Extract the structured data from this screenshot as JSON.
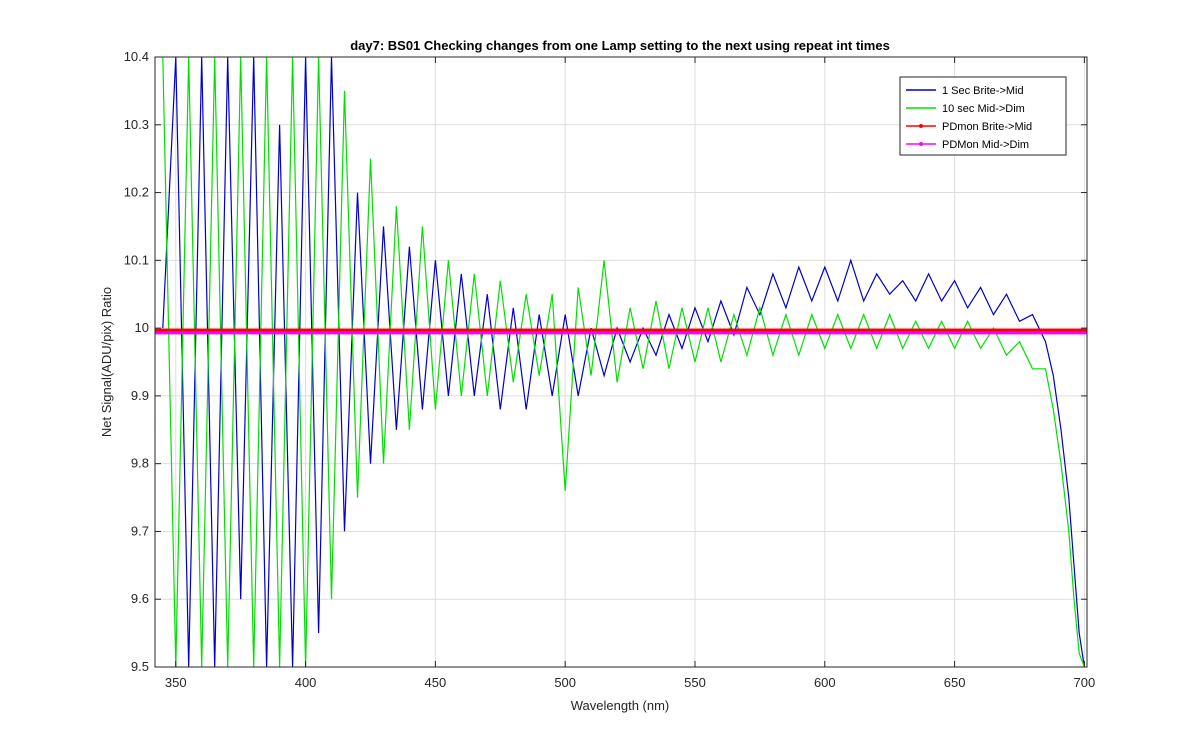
{
  "chart_data": {
    "type": "line",
    "title": "day7: BS01  Checking changes from one Lamp setting to the next using repeat int times",
    "xlabel": "Wavelength (nm)",
    "ylabel": "Net Signal(ADU/pix) Ratio",
    "xlim": [
      342,
      701
    ],
    "ylim": [
      9.5,
      10.4
    ],
    "xticks": [
      350,
      400,
      450,
      500,
      550,
      600,
      650,
      700
    ],
    "xtick_labels": [
      "350",
      "400",
      "450",
      "500",
      "550",
      "600",
      "650",
      "700"
    ],
    "yticks": [
      9.5,
      9.6,
      9.7,
      9.8,
      9.9,
      10,
      10.1,
      10.2,
      10.3,
      10.4
    ],
    "ytick_labels": [
      "9.5",
      "9.6",
      "9.7",
      "9.8",
      "9.9",
      "10",
      "10.1",
      "10.2",
      "10.3",
      "10.4"
    ],
    "grid": true,
    "legend_position": "top-right",
    "series": [
      {
        "name": "1 Sec Brite->Mid",
        "color": "#0000cc",
        "marker": "none",
        "x": [
          345,
          350,
          355,
          360,
          365,
          370,
          375,
          380,
          385,
          390,
          395,
          400,
          405,
          410,
          415,
          420,
          425,
          430,
          435,
          440,
          445,
          450,
          455,
          460,
          465,
          470,
          475,
          480,
          485,
          490,
          495,
          500,
          505,
          510,
          515,
          520,
          525,
          530,
          535,
          540,
          545,
          550,
          555,
          560,
          565,
          570,
          575,
          580,
          585,
          590,
          595,
          600,
          605,
          610,
          615,
          620,
          625,
          630,
          635,
          640,
          645,
          650,
          655,
          660,
          665,
          670,
          675,
          680,
          685,
          688,
          691,
          694,
          696,
          698,
          700
        ],
        "y": [
          10.0,
          10.4,
          9.5,
          10.4,
          9.5,
          10.4,
          9.6,
          10.4,
          9.5,
          10.3,
          9.5,
          10.4,
          9.55,
          10.4,
          9.7,
          10.2,
          9.8,
          10.15,
          9.85,
          10.12,
          9.88,
          10.1,
          9.9,
          10.08,
          9.9,
          10.05,
          9.88,
          10.03,
          9.88,
          10.02,
          9.9,
          10.02,
          9.9,
          10.0,
          9.93,
          10.0,
          9.95,
          10.0,
          9.96,
          10.02,
          9.97,
          10.03,
          9.98,
          10.04,
          9.99,
          10.06,
          10.02,
          10.08,
          10.03,
          10.09,
          10.04,
          10.09,
          10.04,
          10.1,
          10.04,
          10.08,
          10.05,
          10.07,
          10.04,
          10.08,
          10.04,
          10.07,
          10.03,
          10.06,
          10.02,
          10.05,
          10.01,
          10.02,
          9.98,
          9.93,
          9.85,
          9.75,
          9.65,
          9.55,
          9.5
        ]
      },
      {
        "name": "10 sec Mid->Dim",
        "color": "#00e000",
        "marker": "none",
        "x": [
          345,
          350,
          355,
          360,
          365,
          370,
          375,
          380,
          385,
          390,
          395,
          400,
          405,
          410,
          415,
          420,
          425,
          430,
          435,
          440,
          445,
          450,
          455,
          460,
          465,
          470,
          475,
          480,
          485,
          490,
          495,
          500,
          505,
          510,
          515,
          520,
          525,
          530,
          535,
          540,
          545,
          550,
          555,
          560,
          565,
          570,
          575,
          580,
          585,
          590,
          595,
          600,
          605,
          610,
          615,
          620,
          625,
          630,
          635,
          640,
          645,
          650,
          655,
          660,
          665,
          670,
          675,
          680,
          685,
          688,
          691,
          694,
          696,
          698,
          700
        ],
        "y": [
          10.4,
          9.5,
          10.4,
          9.5,
          10.4,
          9.5,
          10.4,
          9.5,
          10.4,
          9.5,
          10.4,
          9.5,
          10.4,
          9.6,
          10.35,
          9.75,
          10.25,
          9.8,
          10.18,
          9.85,
          10.15,
          9.88,
          10.1,
          9.9,
          10.08,
          9.9,
          10.07,
          9.92,
          10.05,
          9.93,
          10.05,
          9.76,
          10.06,
          9.93,
          10.1,
          9.92,
          10.03,
          9.94,
          10.04,
          9.94,
          10.03,
          9.95,
          10.03,
          9.95,
          10.02,
          9.96,
          10.03,
          9.96,
          10.02,
          9.96,
          10.02,
          9.97,
          10.02,
          9.97,
          10.02,
          9.97,
          10.02,
          9.97,
          10.01,
          9.97,
          10.01,
          9.97,
          10.01,
          9.97,
          10.0,
          9.96,
          9.98,
          9.94,
          9.94,
          9.88,
          9.8,
          9.7,
          9.6,
          9.52,
          9.5
        ]
      },
      {
        "name": "PDmon Brite->Mid",
        "color": "#ff0000",
        "marker": "dot",
        "x": [
          342,
          701
        ],
        "y": [
          9.997,
          9.997
        ]
      },
      {
        "name": "PDMon Mid->Dim",
        "color": "#ff00ff",
        "marker": "dot",
        "x": [
          342,
          701
        ],
        "y": [
          9.993,
          9.993
        ]
      }
    ]
  }
}
